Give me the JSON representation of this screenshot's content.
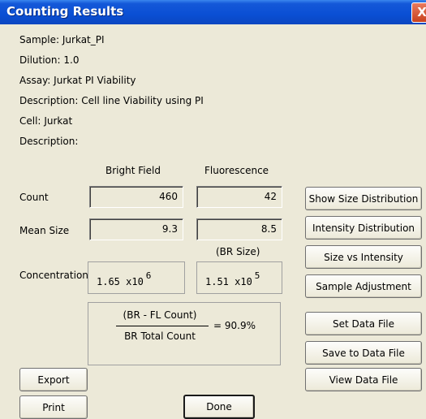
{
  "window": {
    "title": "Counting Results",
    "close_glyph": "X"
  },
  "info": [
    {
      "label": "Sample:",
      "value": "Jurkat_PI"
    },
    {
      "label": "Dilution:",
      "value": "1.0"
    },
    {
      "label": "Assay:",
      "value": "Jurkat PI Viability"
    },
    {
      "label": "Description:",
      "value": "Cell line Viability using PI"
    },
    {
      "label": "Cell:",
      "value": "Jurkat"
    },
    {
      "label": "Description:",
      "value": ""
    }
  ],
  "columns": {
    "bright_field": "Bright Field",
    "fluorescence": "Fluorescence"
  },
  "rows": {
    "count": {
      "label": "Count",
      "bf": "460",
      "fl": "42"
    },
    "mean_size": {
      "label": "Mean Size",
      "bf": "9.3",
      "fl": "8.5"
    },
    "br_size_label": "(BR Size)",
    "concentration": {
      "label": "Concentration",
      "bf_mantissa": "1.65 x10",
      "bf_exp": "6",
      "fl_mantissa": "1.51 x10",
      "fl_exp": "5"
    }
  },
  "ratio": {
    "numerator": "(BR - FL Count)",
    "denominator": "BR Total Count",
    "equals": "=",
    "value": "90.9%"
  },
  "buttons": {
    "show_size_distribution": "Show Size Distribution",
    "intensity_distribution": "Intensity Distribution",
    "size_vs_intensity": "Size vs Intensity",
    "sample_adjustment": "Sample Adjustment",
    "set_data_file": "Set Data File",
    "save_to_data_file": "Save to Data File",
    "view_data_file": "View Data File",
    "export": "Export",
    "print": "Print",
    "done": "Done"
  }
}
